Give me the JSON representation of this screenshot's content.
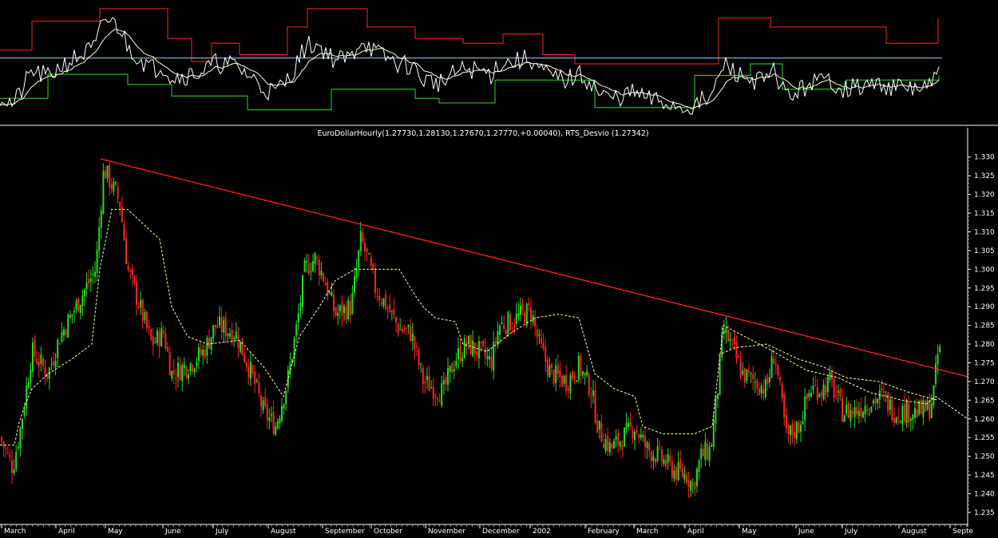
{
  "colors": {
    "background": "#000000",
    "up_candle": "#22dd22",
    "down_candle": "#ff2222",
    "trendline": "#ff2222",
    "moving_average": "#ffff99",
    "axis": "#ffffff",
    "upper_band": "#ff2222",
    "lower_band": "#22dd22",
    "oscillator": "#ffffff",
    "oscillator_signal": "#ffffcc",
    "midline": "#9ad6ff"
  },
  "indicator_panel": {
    "description": "upper/lower channel with oscillator",
    "midline_level": 0.55
  },
  "chart_data": {
    "type": "candlestick",
    "title": "EuroDollarHourly(1.27730,1.28130,1.27670,1.27770,+0.00040), RTS_Desvio (1.27342)",
    "x_tick_labels": [
      "March",
      "April",
      "May",
      "June",
      "July",
      "August",
      "September",
      "October",
      "November",
      "December",
      "2002",
      "February",
      "March",
      "April",
      "May",
      "June",
      "July",
      "August",
      "Septe"
    ],
    "y_tick_labels": [
      "1.330",
      "1.325",
      "1.320",
      "1.315",
      "1.310",
      "1.305",
      "1.300",
      "1.295",
      "1.290",
      "1.285",
      "1.280",
      "1.275",
      "1.270",
      "1.265",
      "1.260",
      "1.255",
      "1.250",
      "1.245",
      "1.240",
      "1.235"
    ],
    "ylim": [
      1.232,
      1.334
    ],
    "grid": false,
    "price_path_keypoints": [
      [
        0,
        1.255
      ],
      [
        8,
        1.251
      ],
      [
        16,
        1.247
      ],
      [
        26,
        1.258
      ],
      [
        40,
        1.278
      ],
      [
        60,
        1.272
      ],
      [
        75,
        1.282
      ],
      [
        100,
        1.292
      ],
      [
        120,
        1.3
      ],
      [
        130,
        1.327
      ],
      [
        150,
        1.318
      ],
      [
        160,
        1.3
      ],
      [
        175,
        1.29
      ],
      [
        190,
        1.28
      ],
      [
        205,
        1.283
      ],
      [
        215,
        1.272
      ],
      [
        240,
        1.275
      ],
      [
        255,
        1.278
      ],
      [
        270,
        1.285
      ],
      [
        295,
        1.283
      ],
      [
        315,
        1.272
      ],
      [
        330,
        1.262
      ],
      [
        345,
        1.258
      ],
      [
        360,
        1.27
      ],
      [
        372,
        1.285
      ],
      [
        382,
        1.3
      ],
      [
        395,
        1.303
      ],
      [
        405,
        1.298
      ],
      [
        420,
        1.288
      ],
      [
        440,
        1.29
      ],
      [
        452,
        1.308
      ],
      [
        460,
        1.303
      ],
      [
        470,
        1.295
      ],
      [
        485,
        1.29
      ],
      [
        500,
        1.284
      ],
      [
        515,
        1.283
      ],
      [
        530,
        1.27
      ],
      [
        545,
        1.268
      ],
      [
        555,
        1.267
      ],
      [
        570,
        1.276
      ],
      [
        585,
        1.28
      ],
      [
        600,
        1.278
      ],
      [
        615,
        1.275
      ],
      [
        625,
        1.285
      ],
      [
        640,
        1.286
      ],
      [
        655,
        1.288
      ],
      [
        665,
        1.289
      ],
      [
        675,
        1.28
      ],
      [
        690,
        1.272
      ],
      [
        710,
        1.27
      ],
      [
        725,
        1.274
      ],
      [
        740,
        1.268
      ],
      [
        750,
        1.257
      ],
      [
        765,
        1.252
      ],
      [
        780,
        1.255
      ],
      [
        795,
        1.258
      ],
      [
        810,
        1.252
      ],
      [
        825,
        1.25
      ],
      [
        845,
        1.246
      ],
      [
        860,
        1.245
      ],
      [
        868,
        1.242
      ],
      [
        878,
        1.25
      ],
      [
        890,
        1.252
      ],
      [
        900,
        1.27
      ],
      [
        906,
        1.284
      ],
      [
        915,
        1.28
      ],
      [
        930,
        1.272
      ],
      [
        945,
        1.27
      ],
      [
        960,
        1.268
      ],
      [
        970,
        1.278
      ],
      [
        985,
        1.255
      ],
      [
        1000,
        1.258
      ],
      [
        1015,
        1.268
      ],
      [
        1030,
        1.268
      ],
      [
        1040,
        1.27
      ],
      [
        1055,
        1.262
      ],
      [
        1070,
        1.262
      ],
      [
        1085,
        1.264
      ],
      [
        1105,
        1.266
      ],
      [
        1120,
        1.262
      ],
      [
        1140,
        1.262
      ],
      [
        1155,
        1.262
      ],
      [
        1165,
        1.263
      ],
      [
        1170,
        1.268
      ],
      [
        1175,
        1.278
      ],
      [
        1178,
        1.278
      ]
    ],
    "trendline": {
      "x": [
        126,
        1212
      ],
      "y": [
        1.3295,
        1.2713
      ]
    },
    "moving_average_dashed": [
      [
        0,
        1.253
      ],
      [
        18,
        1.253
      ],
      [
        24,
        1.259
      ],
      [
        30,
        1.263
      ],
      [
        40,
        1.268
      ],
      [
        60,
        1.272
      ],
      [
        90,
        1.276
      ],
      [
        115,
        1.28
      ],
      [
        125,
        1.3
      ],
      [
        140,
        1.316
      ],
      [
        160,
        1.316
      ],
      [
        200,
        1.308
      ],
      [
        215,
        1.29
      ],
      [
        235,
        1.282
      ],
      [
        260,
        1.28
      ],
      [
        300,
        1.281
      ],
      [
        330,
        1.274
      ],
      [
        355,
        1.266
      ],
      [
        375,
        1.282
      ],
      [
        400,
        1.29
      ],
      [
        420,
        1.297
      ],
      [
        445,
        1.3
      ],
      [
        500,
        1.3
      ],
      [
        520,
        1.293
      ],
      [
        530,
        1.29
      ],
      [
        545,
        1.287
      ],
      [
        570,
        1.286
      ],
      [
        580,
        1.28
      ],
      [
        610,
        1.278
      ],
      [
        640,
        1.283
      ],
      [
        670,
        1.287
      ],
      [
        700,
        1.288
      ],
      [
        725,
        1.287
      ],
      [
        745,
        1.272
      ],
      [
        770,
        1.268
      ],
      [
        795,
        1.266
      ],
      [
        805,
        1.258
      ],
      [
        830,
        1.256
      ],
      [
        870,
        1.256
      ],
      [
        892,
        1.258
      ],
      [
        906,
        1.285
      ],
      [
        960,
        1.279
      ],
      [
        1010,
        1.273
      ],
      [
        1050,
        1.271
      ],
      [
        1090,
        1.267
      ],
      [
        1130,
        1.265
      ],
      [
        1160,
        1.264
      ],
      [
        1172,
        1.266
      ],
      [
        1212,
        1.26
      ]
    ],
    "moving_average_dashed2": [
      [
        900,
        1.277
      ],
      [
        920,
        1.279
      ],
      [
        960,
        1.28
      ],
      [
        1000,
        1.276
      ],
      [
        1030,
        1.274
      ],
      [
        1060,
        1.271
      ],
      [
        1100,
        1.27
      ],
      [
        1140,
        1.267
      ],
      [
        1175,
        1.265
      ]
    ]
  }
}
